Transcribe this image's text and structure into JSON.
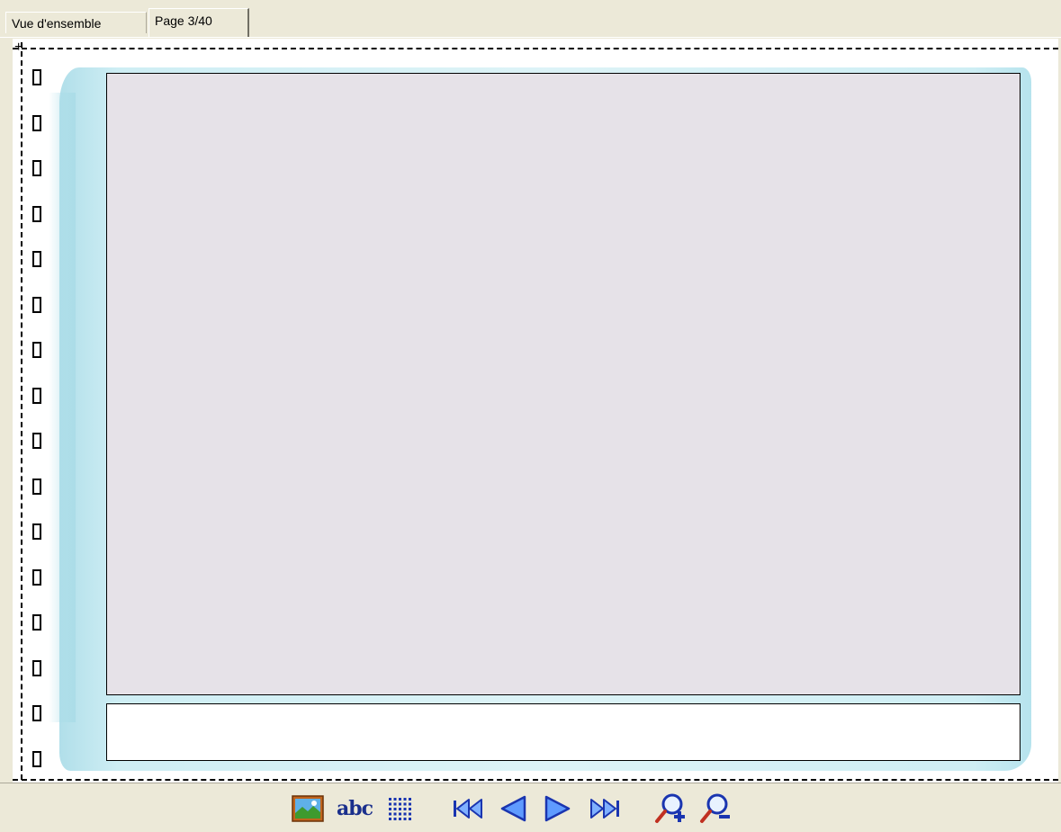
{
  "tabs": [
    {
      "label": "Vue d'ensemble",
      "active": false
    },
    {
      "label": "Page 3/40",
      "active": true
    }
  ],
  "page": {
    "ring_count": 16,
    "photo_placeholder_color": "#e6e2e8",
    "wash_color": "#a8dbe7"
  },
  "toolbar": {
    "buttons": [
      {
        "name": "insert-image-button",
        "icon": "landscape-image-icon"
      },
      {
        "name": "insert-text-button",
        "icon": "abc-text-icon",
        "label": "abc"
      },
      {
        "name": "grid-button",
        "icon": "dot-grid-icon"
      },
      {
        "name": "first-page-button",
        "icon": "skip-first-icon"
      },
      {
        "name": "previous-page-button",
        "icon": "arrow-left-icon"
      },
      {
        "name": "next-page-button",
        "icon": "arrow-right-icon"
      },
      {
        "name": "last-page-button",
        "icon": "skip-last-icon"
      },
      {
        "name": "zoom-in-button",
        "icon": "zoom-in-icon"
      },
      {
        "name": "zoom-out-button",
        "icon": "zoom-out-icon"
      }
    ]
  }
}
